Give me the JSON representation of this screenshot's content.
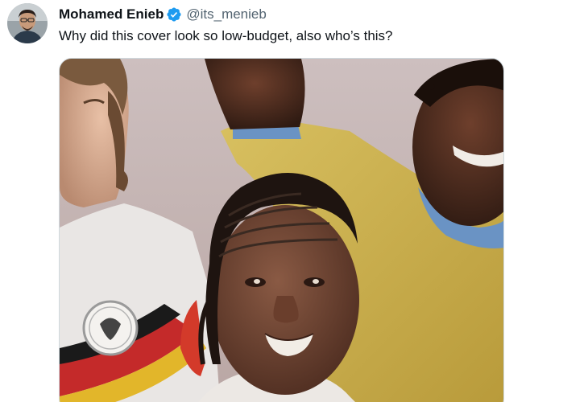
{
  "tweet": {
    "author": {
      "display_name": "Mohamed Enieb",
      "handle": "@its_menieb",
      "verified": true,
      "verified_icon": "verified-badge-icon",
      "avatar": "user-avatar-photo"
    },
    "text": "Why did this cover look so low-budget, also who’s this?",
    "media": {
      "type": "image",
      "subject": "game-cover-artwork-three-footballers"
    }
  },
  "colors": {
    "verified_blue": "#1d9bf0",
    "name_text": "#0f1419",
    "handle_gray": "#536471",
    "media_border": "#cfd9de"
  }
}
